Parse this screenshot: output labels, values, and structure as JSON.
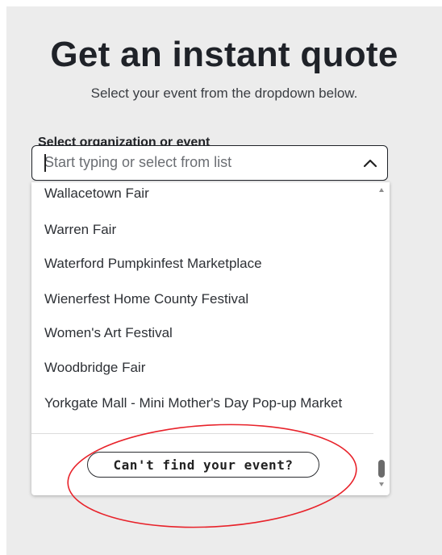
{
  "header": {
    "title": "Get an instant quote",
    "subtitle": "Select your event from the dropdown below."
  },
  "field": {
    "label": "Select organization or event",
    "placeholder": "Start typing or select from list",
    "value": ""
  },
  "dropdown": {
    "options": [
      {
        "label": "Wallacetown Fair"
      },
      {
        "label": "Warren Fair"
      },
      {
        "label": "Waterford Pumpkinfest Marketplace"
      },
      {
        "label": "Wienerfest Home County Festival"
      },
      {
        "label": "Women's Art Festival"
      },
      {
        "label": "Woodbridge Fair"
      },
      {
        "label": "Yorkgate Mall - Mini Mother's Day Pop-up Market"
      }
    ],
    "cant_find_label": "Can't find your event?"
  },
  "icons": {
    "toggle": "chevron-up-icon",
    "scroll_up": "scroll-up-arrow-icon",
    "scroll_down": "scroll-down-arrow-icon"
  },
  "colors": {
    "background": "#ececec",
    "text": "#1f2228",
    "annotation": "#e8222a"
  }
}
